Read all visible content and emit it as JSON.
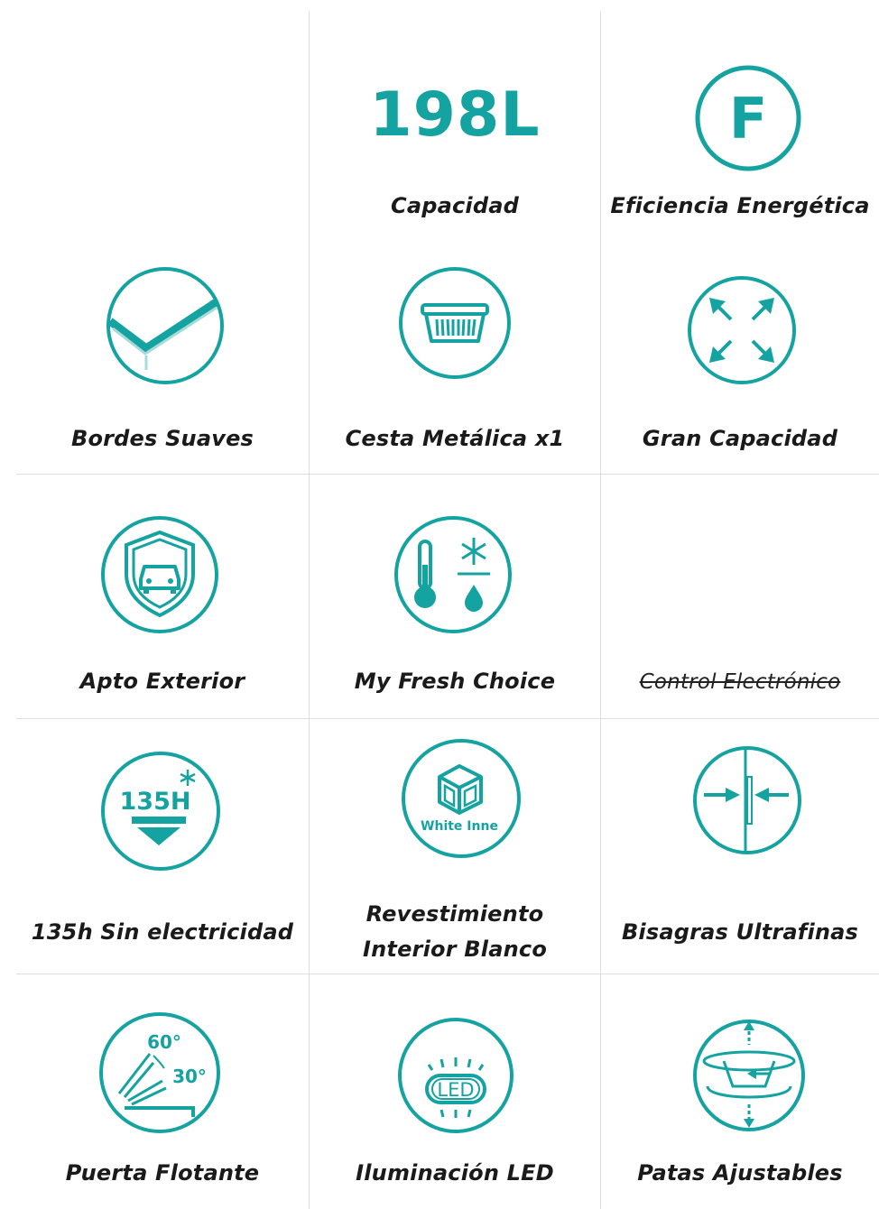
{
  "colors": {
    "accent": "#15a3a1",
    "text": "#1a1a1a",
    "grid": "#dedede"
  },
  "features": {
    "capacity": {
      "value": "198L",
      "label": "Capacidad"
    },
    "efficiency": {
      "grade": "F",
      "label": "Eficiencia Energética"
    },
    "soft_edges": {
      "icon": "soft-edges-icon",
      "label": "Bordes Suaves"
    },
    "basket": {
      "icon": "metal-basket-icon",
      "label": "Cesta Metálica x1"
    },
    "big_capacity": {
      "icon": "expand-arrows-icon",
      "label": "Gran Capacidad"
    },
    "outdoor": {
      "icon": "shield-car-icon",
      "label": "Apto Exterior"
    },
    "fresh_choice": {
      "icon": "thermometer-snowflake-icon",
      "label": "My Fresh Choice"
    },
    "electronic": {
      "label": "Control Electrónico",
      "struck_through": true
    },
    "hours": {
      "icon": "135h-icon",
      "icon_text": "135H",
      "label": "135h Sin electricidad"
    },
    "white_interior": {
      "icon": "white-inner-cube-icon",
      "icon_text": "White Inne",
      "label_line1": "Revestimiento",
      "label_line2": "Interior Blanco"
    },
    "hinges": {
      "icon": "ultrathin-hinge-icon",
      "label": "Bisagras Ultrafinas"
    },
    "floating_door": {
      "icon": "floating-door-icon",
      "angle1": "60°",
      "angle2": "30°",
      "label": "Puerta Flotante"
    },
    "led": {
      "icon": "led-light-icon",
      "icon_text": "LED",
      "label": "Iluminación LED"
    },
    "legs": {
      "icon": "adjustable-legs-icon",
      "label": "Patas Ajustables"
    }
  }
}
